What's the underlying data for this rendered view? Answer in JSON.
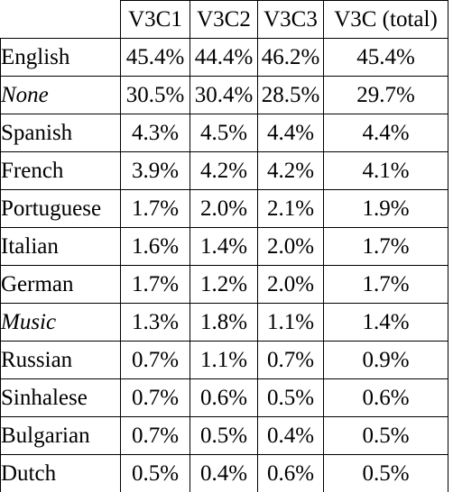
{
  "table": {
    "columns": [
      {
        "key": "label",
        "label": "",
        "align": "left"
      },
      {
        "key": "v3c1",
        "label": "V3C1",
        "align": "center"
      },
      {
        "key": "v3c2",
        "label": "V3C2",
        "align": "center"
      },
      {
        "key": "v3c3",
        "label": "V3C3",
        "align": "center"
      },
      {
        "key": "total",
        "label": "V3C  (total)",
        "align": "center"
      }
    ],
    "rows": [
      {
        "label": "English",
        "italic": false,
        "v3c1": "45.4%",
        "v3c2": "44.4%",
        "v3c3": "46.2%",
        "total": "45.4%"
      },
      {
        "label": "None",
        "italic": true,
        "v3c1": "30.5%",
        "v3c2": "30.4%",
        "v3c3": "28.5%",
        "total": "29.7%"
      },
      {
        "label": "Spanish",
        "italic": false,
        "v3c1": "4.3%",
        "v3c2": "4.5%",
        "v3c3": "4.4%",
        "total": "4.4%"
      },
      {
        "label": "French",
        "italic": false,
        "v3c1": "3.9%",
        "v3c2": "4.2%",
        "v3c3": "4.2%",
        "total": "4.1%"
      },
      {
        "label": "Portuguese",
        "italic": false,
        "v3c1": "1.7%",
        "v3c2": "2.0%",
        "v3c3": "2.1%",
        "total": "1.9%"
      },
      {
        "label": "Italian",
        "italic": false,
        "v3c1": "1.6%",
        "v3c2": "1.4%",
        "v3c3": "2.0%",
        "total": "1.7%"
      },
      {
        "label": "German",
        "italic": false,
        "v3c1": "1.7%",
        "v3c2": "1.2%",
        "v3c3": "2.0%",
        "total": "1.7%"
      },
      {
        "label": "Music",
        "italic": true,
        "v3c1": "1.3%",
        "v3c2": "1.8%",
        "v3c3": "1.1%",
        "total": "1.4%"
      },
      {
        "label": "Russian",
        "italic": false,
        "v3c1": "0.7%",
        "v3c2": "1.1%",
        "v3c3": "0.7%",
        "total": "0.9%"
      },
      {
        "label": "Sinhalese",
        "italic": false,
        "v3c1": "0.7%",
        "v3c2": "0.6%",
        "v3c3": "0.5%",
        "total": "0.6%"
      },
      {
        "label": "Bulgarian",
        "italic": false,
        "v3c1": "0.7%",
        "v3c2": "0.5%",
        "v3c3": "0.4%",
        "total": "0.5%"
      },
      {
        "label": "Dutch",
        "italic": false,
        "v3c1": "0.5%",
        "v3c2": "0.4%",
        "v3c3": "0.6%",
        "total": "0.5%"
      }
    ]
  }
}
